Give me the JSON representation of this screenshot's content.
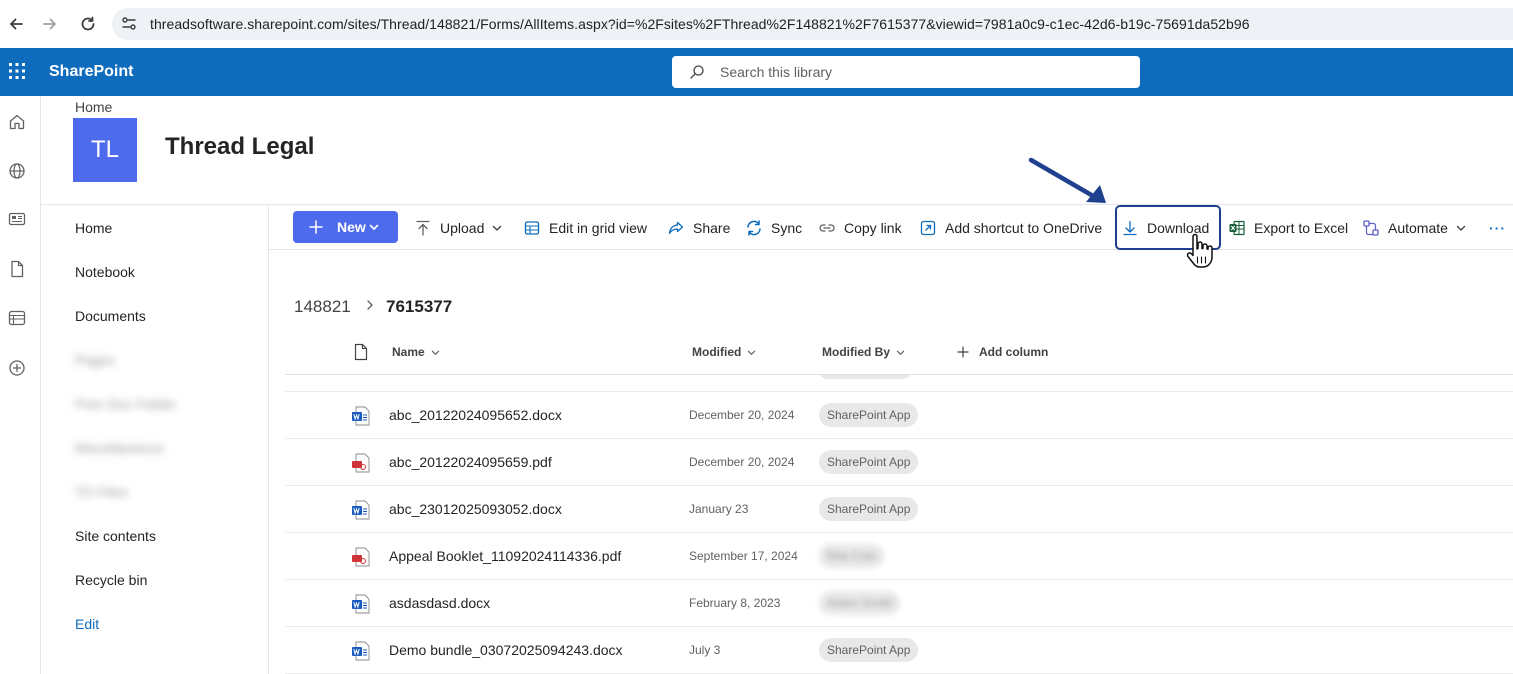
{
  "browser": {
    "url": "threadsoftware.sharepoint.com/sites/Thread/148821/Forms/AllItems.aspx?id=%2Fsites%2FThread%2F148821%2F7615377&viewid=7981a0c9-c1ec-42d6-b19c-75691da52b96"
  },
  "suite": {
    "brand": "SharePoint",
    "search_placeholder": "Search this library"
  },
  "site": {
    "breadcrumb": "Home",
    "logo_initials": "TL",
    "logo_color": "#4f6bed",
    "title": "Thread Legal"
  },
  "left_nav": {
    "items": [
      {
        "label": "Home"
      },
      {
        "label": "Notebook"
      },
      {
        "label": "Documents"
      },
      {
        "label": "Pages"
      },
      {
        "label": "Prev Doc Folder"
      },
      {
        "label": "Miscellaneous"
      },
      {
        "label": "TO Files"
      },
      {
        "label": "Site contents"
      },
      {
        "label": "Recycle bin"
      },
      {
        "label": "Edit"
      }
    ]
  },
  "command_bar": {
    "new": "New",
    "upload": "Upload",
    "edit_grid": "Edit in grid view",
    "share": "Share",
    "sync": "Sync",
    "copy_link": "Copy link",
    "add_shortcut": "Add shortcut to OneDrive",
    "download": "Download",
    "export_excel": "Export to Excel",
    "automate": "Automate",
    "more": "···"
  },
  "library": {
    "breadcrumb_root": "148821",
    "breadcrumb_current": "7615377",
    "columns": {
      "name": "Name",
      "modified": "Modified",
      "modified_by": "Modified By",
      "add_column": "Add column"
    },
    "files": [
      {
        "name": "abc_20122024095652.docx",
        "type": "docx",
        "modified": "December 20, 2024",
        "modified_by": "SharePoint App"
      },
      {
        "name": "abc_20122024095659.pdf",
        "type": "pdf",
        "modified": "December 20, 2024",
        "modified_by": "SharePoint App"
      },
      {
        "name": "abc_23012025093052.docx",
        "type": "docx",
        "modified": "January 23",
        "modified_by": "SharePoint App"
      },
      {
        "name": "Appeal Booklet_11092024114336.pdf",
        "type": "pdf",
        "modified": "September 17, 2024",
        "modified_by": "Rita Cole"
      },
      {
        "name": "asdasdasd.docx",
        "type": "docx",
        "modified": "February 8, 2023",
        "modified_by": "Adam Smith"
      },
      {
        "name": "Demo bundle_03072025094243.docx",
        "type": "docx",
        "modified": "July 3",
        "modified_by": "SharePoint App"
      }
    ]
  },
  "colors": {
    "suite_bar": "#0f6cbd",
    "primary_button": "#4f6bed",
    "annotation": "#1f3f8f",
    "word_blue": "#185abd",
    "pdf_red": "#d13438"
  }
}
